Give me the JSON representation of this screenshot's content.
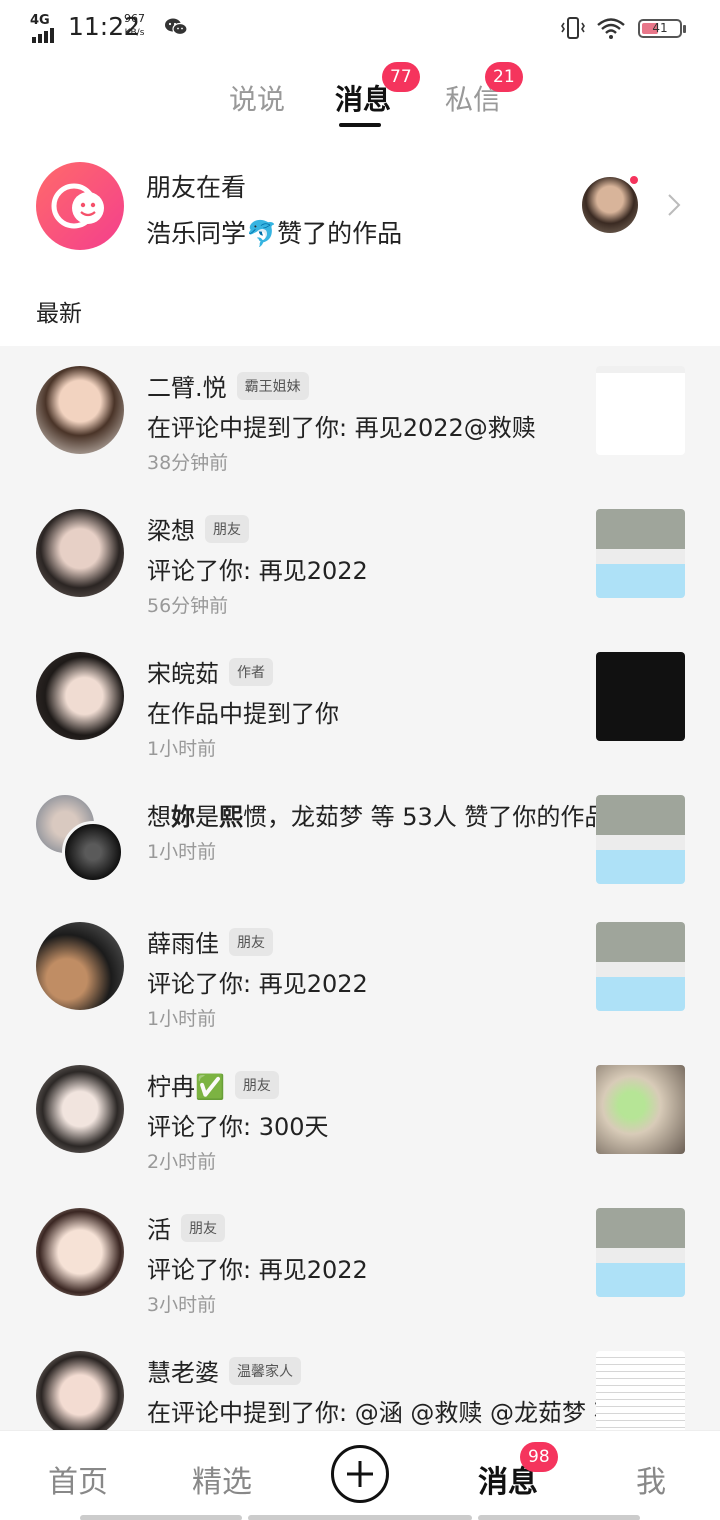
{
  "status_bar": {
    "network": "4G",
    "time": "11:22",
    "speed_value": "967",
    "speed_unit": "KB/s",
    "battery": "41",
    "battery_level": 0.41,
    "icons": [
      "signal-icon",
      "wechat-icon",
      "vibrate-icon",
      "wifi-icon",
      "battery-icon"
    ]
  },
  "tabs": [
    {
      "label": "说说",
      "active": false
    },
    {
      "label": "消息",
      "active": true,
      "badge": "77"
    },
    {
      "label": "私信",
      "active": false,
      "badge": "21"
    }
  ],
  "friends_watching": {
    "title": "朋友在看",
    "subtitle": "浩乐同学🐬赞了的作品",
    "icon": "smile-bubble-icon"
  },
  "section_label": "最新",
  "notifications": [
    {
      "name": "二臂.悦",
      "tag": "霸王姐妹",
      "content": "在评论中提到了你: 再见2022@救赎",
      "time": "38分钟前"
    },
    {
      "name": "梁想",
      "tag": "朋友",
      "content": "评论了你: 再见2022",
      "time": "56分钟前"
    },
    {
      "name": "宋皖茹",
      "tag": "作者",
      "content": "在作品中提到了你",
      "time": "1小时前"
    },
    {
      "content_prefix": "想",
      "content_bold1": "妳",
      "content_mid1": "是",
      "content_bold2": "熙",
      "content_rest": "惯，龙茹梦 等 53人 赞了你的作品",
      "time": "1小时前"
    },
    {
      "name": "薛雨佳",
      "tag": "朋友",
      "content": "评论了你: 再见2022",
      "time": "1小时前"
    },
    {
      "name": "柠冉✅",
      "tag": "朋友",
      "content": "评论了你: 300天",
      "time": "2小时前"
    },
    {
      "name": "活",
      "tag": "朋友",
      "content": "评论了你: 再见2022",
      "time": "3小时前"
    },
    {
      "name": "慧老婆",
      "tag": "温馨家人",
      "content": "在评论中提到了你: @涵 @救赎 @龙茹梦 不",
      "time": ""
    }
  ],
  "bottom_nav": {
    "home": "首页",
    "featured": "精选",
    "messages": "消息",
    "messages_badge": "98",
    "me": "我"
  }
}
